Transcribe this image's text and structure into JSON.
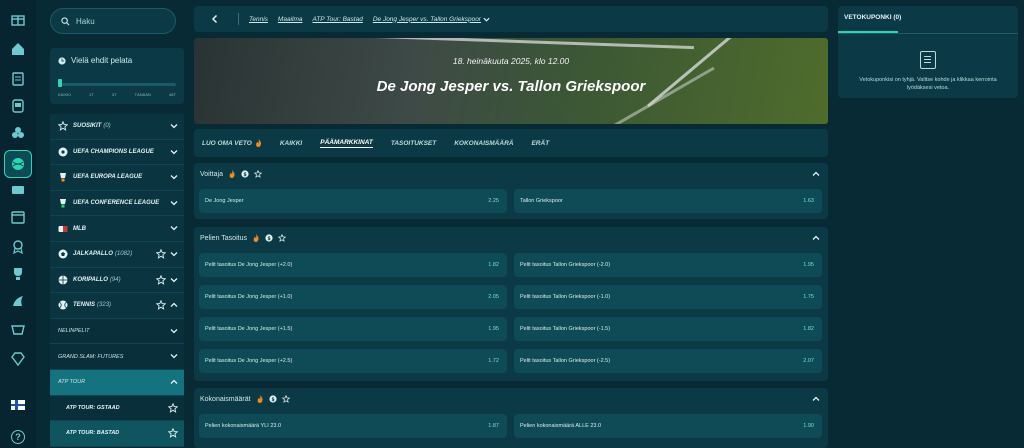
{
  "search": {
    "placeholder": "Haku"
  },
  "live": {
    "title": "Vielä ehdit pelata",
    "progress": 0.02,
    "labels": [
      "KAIKKI",
      "1T",
      "3T",
      "TÄNÄÄN",
      "48T"
    ]
  },
  "sports": [
    {
      "id": "favs",
      "label": "SUOSIKIT",
      "count": "(0)",
      "icon": "star-outline-icon",
      "star": false
    },
    {
      "id": "ucl",
      "label": "UEFA CHAMPIONS LEAGUE",
      "count": "",
      "icon": "ucl-ball-icon",
      "star": false
    },
    {
      "id": "uel",
      "label": "UEFA EUROPA LEAGUE",
      "count": "",
      "icon": "uel-trophy-icon",
      "star": false
    },
    {
      "id": "uecl",
      "label": "UEFA CONFERENCE LEAGUE",
      "count": "",
      "icon": "uecl-trophy-icon",
      "star": false
    },
    {
      "id": "mlb",
      "label": "MLB",
      "count": "",
      "icon": "mlb-logo-icon",
      "star": false
    },
    {
      "id": "football",
      "label": "JALKAPALLO",
      "count": "(1082)",
      "icon": "football-icon",
      "star": true
    },
    {
      "id": "basketball",
      "label": "KORIPALLO",
      "count": "(94)",
      "icon": "basketball-icon",
      "star": true
    },
    {
      "id": "tennis",
      "label": "TENNIS",
      "count": "(323)",
      "icon": "tennis-ball-icon",
      "star": true
    }
  ],
  "tennis_sub": [
    {
      "label": "NELINPELIT"
    },
    {
      "label": "GRAND SLAM: FUTURES"
    },
    {
      "label": "ATP TOUR"
    }
  ],
  "atp_leafs": [
    {
      "label": "ATP TOUR: GSTAAD"
    },
    {
      "label": "ATP TOUR: BASTAD"
    }
  ],
  "breadcrumb": [
    "Tennis",
    "Maailma",
    "ATP Tour: Bastad",
    "De Jong Jesper vs. Tallon Griekspoor"
  ],
  "event": {
    "date": "18. heinäkuuta 2025, klo 12.00",
    "title": "De Jong Jesper vs. Tallon Griekspoor"
  },
  "tabs": [
    "LUO OMA VETO",
    "KAIKKI",
    "PÄÄMARKKINAT",
    "TASOITUKSET",
    "KOKONAISMÄÄRÄ",
    "ERÄT"
  ],
  "markets": {
    "winner": {
      "title": "Voittaja",
      "odds": [
        {
          "label": "De Jong Jesper",
          "price": "2.25"
        },
        {
          "label": "Tallon Griekspoor",
          "price": "1.63"
        }
      ]
    },
    "handicap": {
      "title": "Pelien Tasoitus",
      "odds": [
        {
          "label": "Pelit tasoitus De Jong Jesper (+2.0)",
          "price": "1.82"
        },
        {
          "label": "Pelit tasoitus Tallon Griekspoor (-2.0)",
          "price": "1.95"
        },
        {
          "label": "Pelit tasoitus De Jong Jesper (+1.0)",
          "price": "2.05"
        },
        {
          "label": "Pelit tasoitus Tallon Griekspoor (-1.0)",
          "price": "1.75"
        },
        {
          "label": "Pelit tasoitus De Jong Jesper (+1.5)",
          "price": "1.95"
        },
        {
          "label": "Pelit tasoitus Tallon Griekspoor (-1.5)",
          "price": "1.82"
        },
        {
          "label": "Pelit tasoitus De Jong Jesper (+2.5)",
          "price": "1.72"
        },
        {
          "label": "Pelit tasoitus Tallon Griekspoor (-2.5)",
          "price": "2.07"
        }
      ]
    },
    "totals": {
      "title": "Kokonaismäärät",
      "odds": [
        {
          "label": "Pelien kokonaismäärä YLI 23.0",
          "price": "1.87"
        },
        {
          "label": "Pelien kokonaismäärä ALLE 23.0",
          "price": "1.90"
        }
      ]
    }
  },
  "betslip": {
    "title": "VETOKUPONKI (0)",
    "empty_text": "Vetokuponkisi on tyhjä. Valitse kohde ja klikkaa kerrointa lyödäksesi vetoa."
  },
  "colors": {
    "accent": "#2fd4b3",
    "background": "#082a34",
    "panel": "#0b3945",
    "odd_bg": "#0f4a57"
  }
}
